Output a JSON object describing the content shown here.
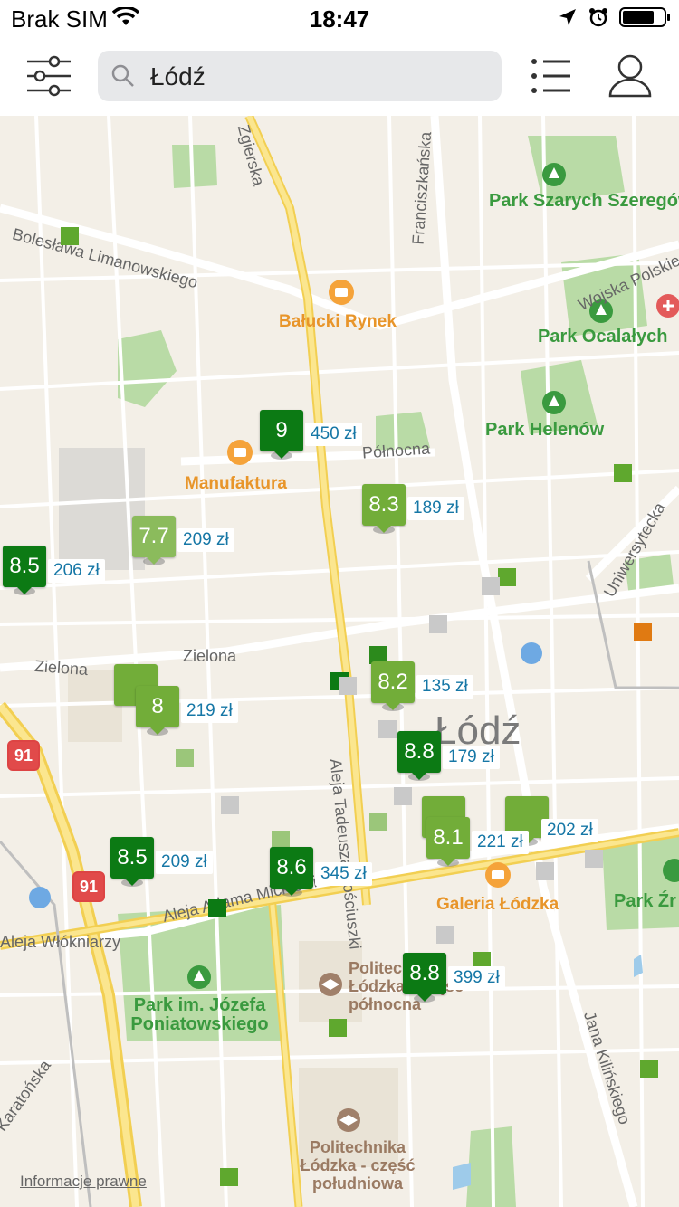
{
  "status": {
    "carrier": "Brak SIM",
    "time": "18:47"
  },
  "search": {
    "value": "Łódź"
  },
  "map": {
    "city_label": "Łódź",
    "legal": "Informacje prawne",
    "pois_green": [
      {
        "text": "Park Szarych Szeregów"
      },
      {
        "text": "Park Ocalałych"
      },
      {
        "text": "Park Helenów"
      },
      {
        "text": "Park im. Józefa Poniatowskiego"
      },
      {
        "text": "Park Źr"
      }
    ],
    "pois_orange": [
      {
        "text": "Bałucki Rynek"
      },
      {
        "text": "Manufaktura"
      },
      {
        "text": "Galeria Łódzka"
      }
    ],
    "pois_brown": [
      {
        "text": "Politechnika Łódzka - część północna"
      },
      {
        "text": "Politechnika Łódzka - część południowa"
      }
    ],
    "streets": [
      {
        "text": "Bolesława Limanowskiego"
      },
      {
        "text": "Północna"
      },
      {
        "text": "Zielona"
      },
      {
        "text": "Zielona"
      },
      {
        "text": "Aleja Tadeusza Kościuszki"
      },
      {
        "text": "Aleja Adama Mickiewicza"
      },
      {
        "text": "Franciszkańska"
      },
      {
        "text": "Wojska Polskiego"
      },
      {
        "text": "Uniwersytecka"
      },
      {
        "text": "Jana Kilińskiego"
      },
      {
        "text": "Zgierska"
      },
      {
        "text": "Karatońska"
      },
      {
        "text": "Aleja Włókniarzy"
      }
    ],
    "routes": [
      "91",
      "91"
    ],
    "markers": [
      {
        "rating": "9",
        "price": "450 zł",
        "color": "#0c7a14"
      },
      {
        "rating": "8.3",
        "price": "189 zł",
        "color": "#72ad39"
      },
      {
        "rating": "7.7",
        "price": "209 zł",
        "color": "#8bbb5c"
      },
      {
        "rating": "8.5",
        "price": "206 zł",
        "color": "#0c7a14"
      },
      {
        "rating": "8",
        "price": "219 zł",
        "color": "#72ad39"
      },
      {
        "rating": "8.2",
        "price": "135 zł",
        "color": "#72ad39"
      },
      {
        "rating": "8.8",
        "price": "179 zł",
        "color": "#0c7a14"
      },
      {
        "rating": "8.1",
        "price": "221 zł",
        "color": "#72ad39"
      },
      {
        "rating": "8.6",
        "price": "345 zł",
        "color": "#0c7a14"
      },
      {
        "rating": "8.5",
        "price": "209 zł",
        "color": "#0c7a14"
      },
      {
        "rating": "8.8",
        "price": "399 zł",
        "color": "#0c7a14"
      },
      {
        "rating": "",
        "price": "202 zł",
        "color": "#72ad39"
      }
    ]
  }
}
